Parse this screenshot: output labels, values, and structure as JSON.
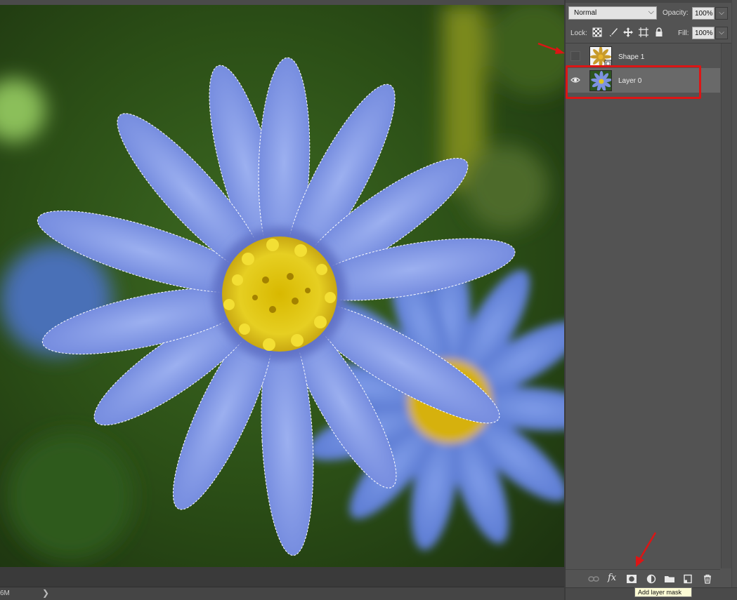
{
  "canvas": {
    "status_size": "6M",
    "status_nav_arrow": "❯",
    "selection": "marching-ants"
  },
  "layers_panel": {
    "blend_mode": "Normal",
    "opacity_label": "Opacity:",
    "opacity_value": "100%",
    "lock_label": "Lock:",
    "fill_label": "Fill:",
    "fill_value": "100%",
    "lock_icons": [
      "lock-transparent-pixels-icon",
      "lock-image-pixels-icon",
      "lock-position-icon",
      "lock-artboard-icon",
      "lock-all-icon"
    ],
    "layers": [
      {
        "name": "Shape 1",
        "visible": false,
        "selected": false
      },
      {
        "name": "Layer 0",
        "visible": true,
        "selected": true
      }
    ],
    "bottom_icons": [
      "link-layers-icon",
      "fx-icon",
      "add-layer-mask-icon",
      "adjustment-layer-icon",
      "folder-icon",
      "new-layer-icon",
      "trash-icon"
    ],
    "fx_label": "fx"
  },
  "tooltip": {
    "text": "Add layer mask"
  },
  "annotations": {
    "color": "#dc1515"
  }
}
